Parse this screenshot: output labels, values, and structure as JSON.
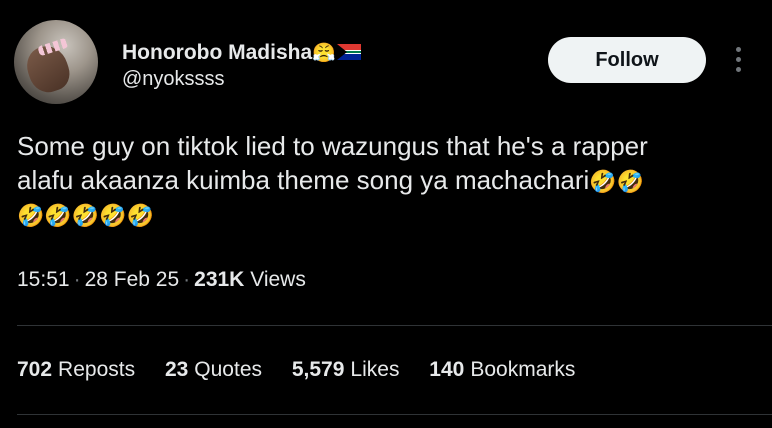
{
  "author": {
    "display_name": "Honorobo Madisha",
    "name_emoji": "😤",
    "flag": "south-africa-flag",
    "handle": "@nyokssss"
  },
  "follow_label": "Follow",
  "tweet": {
    "line1": "Some guy on tiktok lied to wazungus that he's a rapper",
    "line2": "alafu akaanza kuimba theme song ya machachari",
    "line2_emojis": "🤣🤣",
    "line3_emojis": "🤣🤣🤣🤣🤣"
  },
  "meta": {
    "time": "15:51",
    "date": "28 Feb 25",
    "views_count": "231K",
    "views_label": "Views",
    "separator": "·"
  },
  "stats": {
    "reposts": {
      "count": "702",
      "label": "Reposts"
    },
    "quotes": {
      "count": "23",
      "label": "Quotes"
    },
    "likes": {
      "count": "5,579",
      "label": "Likes"
    },
    "bookmarks": {
      "count": "140",
      "label": "Bookmarks"
    }
  },
  "icons": {
    "more": "more-vertical-icon"
  },
  "colors": {
    "background": "#000000",
    "text": "#e7e9ea",
    "muted": "#71767b",
    "follow_bg": "#eff3f4",
    "divider": "#2f3336"
  }
}
